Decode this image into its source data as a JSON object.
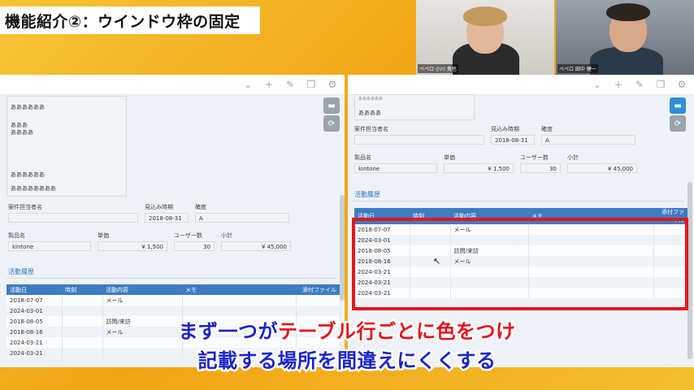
{
  "title": "機能紹介②：ウインドウ枠の固定",
  "cams": [
    "ペペロ 小川 貴也",
    "ペペロ 田中 健一"
  ],
  "left": {
    "textarea_lines": [
      "ああああああ",
      "あああ",
      "ああああ",
      "ああああああ",
      "ああああああああ"
    ],
    "fields": {
      "manager_label": "案件担当者名",
      "manager_value": "",
      "period_label": "見込み時期",
      "period_value": "2018-08-31",
      "confidence_label": "確度",
      "confidence_value": "A",
      "product_label": "製品名",
      "product_value": "kintone",
      "price_label": "単価",
      "price_value": "¥ 1,500",
      "users_label": "ユーザー数",
      "users_value": "30",
      "subtotal_label": "小計",
      "subtotal_value": "¥ 45,000"
    },
    "section": "活動履歴",
    "columns": [
      "活動日",
      "時刻",
      "活動内容",
      "メモ",
      "添付ファイル"
    ],
    "rows": [
      [
        "2018-07-07",
        "",
        "メール",
        "",
        ""
      ],
      [
        "2024-03-01",
        "",
        "",
        "",
        ""
      ],
      [
        "2018-08-05",
        "",
        "訪問/来訪",
        "",
        ""
      ],
      [
        "2018-08-16",
        "",
        "メール",
        "",
        ""
      ],
      [
        "2024-03-21",
        "",
        "",
        "",
        ""
      ],
      [
        "2024-03-21",
        "",
        "",
        "",
        ""
      ]
    ]
  },
  "right": {
    "textarea_lines": [
      "ああああああ",
      "ああああ"
    ],
    "fields": {
      "manager_label": "案件担当者名",
      "manager_value": "",
      "period_label": "見込み時期",
      "period_value": "2018-08-31",
      "confidence_label": "確度",
      "confidence_value": "A",
      "product_label": "製品名",
      "product_value": "kintone",
      "price_label": "単価",
      "price_value": "¥ 1,500",
      "users_label": "ユーザー数",
      "users_value": "30",
      "subtotal_label": "小計",
      "subtotal_value": "¥ 45,000"
    },
    "section": "活動履歴",
    "columns": [
      "活動日",
      "時刻",
      "活動内容",
      "メモ",
      "添付ファイル"
    ],
    "rows": [
      [
        "2018-07-07",
        "",
        "メール",
        "",
        ""
      ],
      [
        "2024-03-01",
        "",
        "",
        "",
        ""
      ],
      [
        "2018-08-05",
        "",
        "訪問/来訪",
        "",
        ""
      ],
      [
        "2018-08-16",
        "",
        "メール",
        "",
        ""
      ],
      [
        "2024-03-21",
        "",
        "",
        "",
        ""
      ],
      [
        "2024-03-21",
        "",
        "",
        "",
        ""
      ],
      [
        "2024-03-21",
        "",
        "",
        "",
        ""
      ]
    ]
  },
  "caption": {
    "line1_a": "まず一つが",
    "line1_b": "テーブル行ごとに色をつけ",
    "line2": "記載する場所を間違えにくくする"
  },
  "colors": {
    "accent": "#e8141c",
    "header_blue": "#3e7cc2",
    "caption_blue": "#1a24c6",
    "background": "#f5b321"
  }
}
